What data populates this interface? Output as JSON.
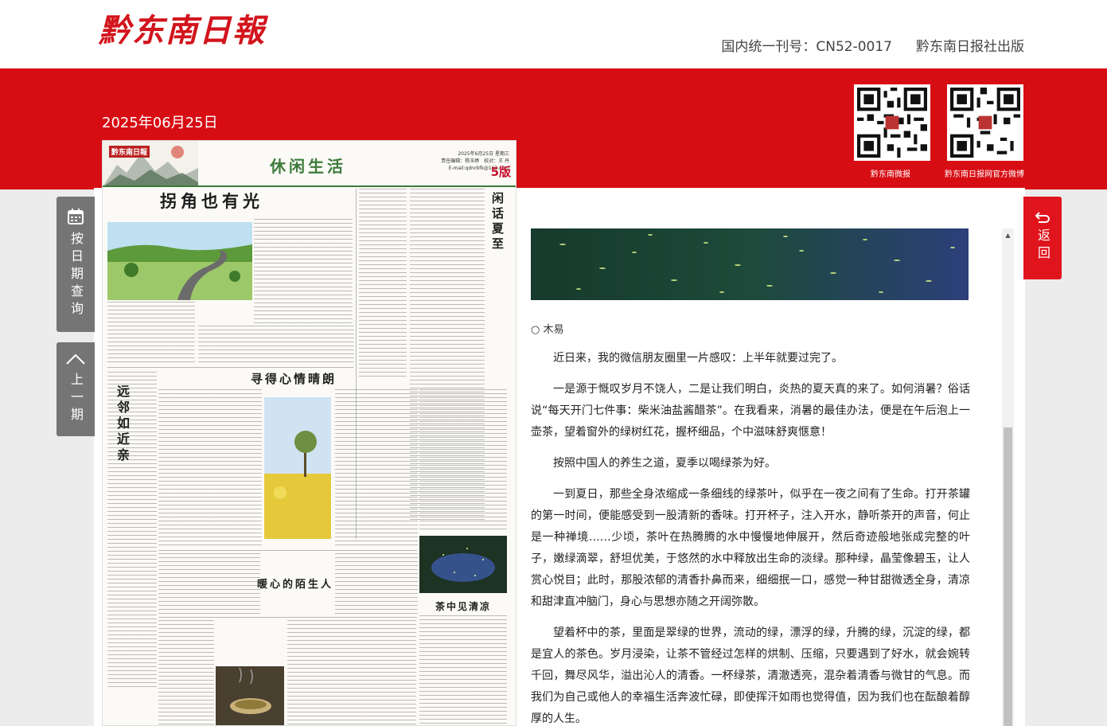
{
  "header": {
    "logo": "黔东南日報",
    "issn": "国内统一刊号：CN52-0017",
    "publisher": "黔东南日报社出版"
  },
  "date": "2025年06月25日",
  "qr": [
    {
      "label": "黔东南微报"
    },
    {
      "label": "黔东南日报网官方微博"
    }
  ],
  "nav": {
    "by_date": "按日期查询",
    "prev": "上一期",
    "back": "返回"
  },
  "paper": {
    "masthead": "黔东南日報",
    "section": "休闲生活",
    "page_no": "5版",
    "meta_line1": "2025年6月25日 星期三",
    "meta_line2": "责任编辑：杨玉婷　校对：王 丹",
    "meta_line3": "E-mail:qdnrbfk@163.com",
    "h_main": "拐角也有光",
    "h_mid": "寻得心情晴朗",
    "h_low": "暖心的陌生人",
    "h_left": "远邻如近亲",
    "h_right": "闲话夏至",
    "h_tea": "茶中见清凉"
  },
  "article": {
    "author": "○ 木易",
    "paragraphs": [
      "近日来，我的微信朋友圈里一片感叹：上半年就要过完了。",
      "一是源于慨叹岁月不饶人，二是让我们明白，炎热的夏天真的来了。如何消暑？俗话说“每天开门七件事：柴米油盐酱醋茶”。在我看来，消暑的最佳办法，便是在午后泡上一壶茶，望着窗外的绿树红花，握杯细品，个中滋味舒爽惬意！",
      "按照中国人的养生之道，夏季以喝绿茶为好。",
      "一到夏日，那些全身浓缩成一条细线的绿茶叶，似乎在一夜之间有了生命。打开茶罐的第一时间，便能感受到一股清新的香味。打开杯子，注入开水，静听茶开的声音，何止是一种禅境……少顷，茶叶在热腾腾的水中慢慢地伸展开，然后奇迹般地张成完整的叶子，嫩绿滴翠，舒坦优美，于悠然的水中释放出生命的淡绿。那种绿，晶莹像碧玉，让人赏心悦目；此时，那股浓郁的清香扑鼻而来，细细抿一口，感觉一种甘甜微透全身，清凉和甜津直冲脑门，身心与思想亦随之开阔弥散。",
      "望着杯中的茶，里面是翠绿的世界，流动的绿，漂浮的绿，升腾的绿，沉淀的绿，都是宜人的茶色。岁月浸染，让茶不管经过怎样的烘制、压缩，只要遇到了好水，就会婉转千回，舞尽风华，溢出沁人的清香。一杯绿茶，清澈透亮，混杂着清香与微甘的气息。而我们为自己或他人的幸福生活奔波忙碌，即使挥汗如雨也觉得值，因为我们也在酝酿着醇厚的人生。"
    ]
  }
}
